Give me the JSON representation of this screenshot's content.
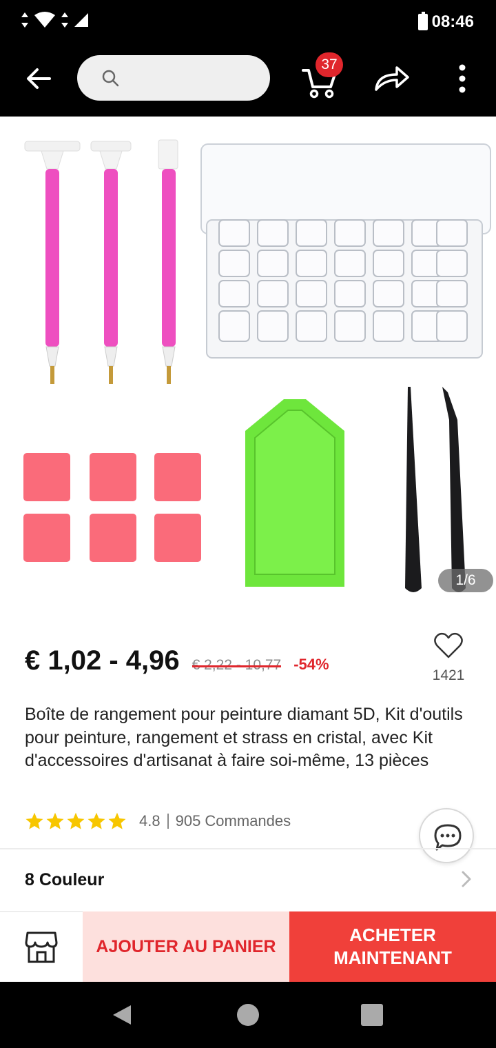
{
  "status_bar": {
    "time": "08:46"
  },
  "header": {
    "search": {
      "placeholder": "",
      "icon": "search-icon"
    },
    "cart_count": "37"
  },
  "product": {
    "image_counter": "1/6",
    "price": "€ 1,02 - 4,96",
    "old_price": "€ 2,22 - 10,77",
    "discount": "-54%",
    "wishlist_count": "1421",
    "title": "Boîte de rangement pour peinture diamant 5D, Kit d'outils pour peinture, rangement et strass en cristal, avec Kit d'accessoires d'artisanat à faire soi-même, 13 pièces",
    "rating": "4.8",
    "orders": "905 Commandes",
    "stars": 5
  },
  "variants": {
    "label": "8 Couleur"
  },
  "actions": {
    "add_to_cart": "AJOUTER AU PANIER",
    "buy_now": "ACHETER MAINTENANT"
  },
  "colors": {
    "accent": "#e0262c",
    "buy_button": "#f0403a",
    "add_button_bg": "#fde0dd",
    "star": "#f7c600"
  }
}
